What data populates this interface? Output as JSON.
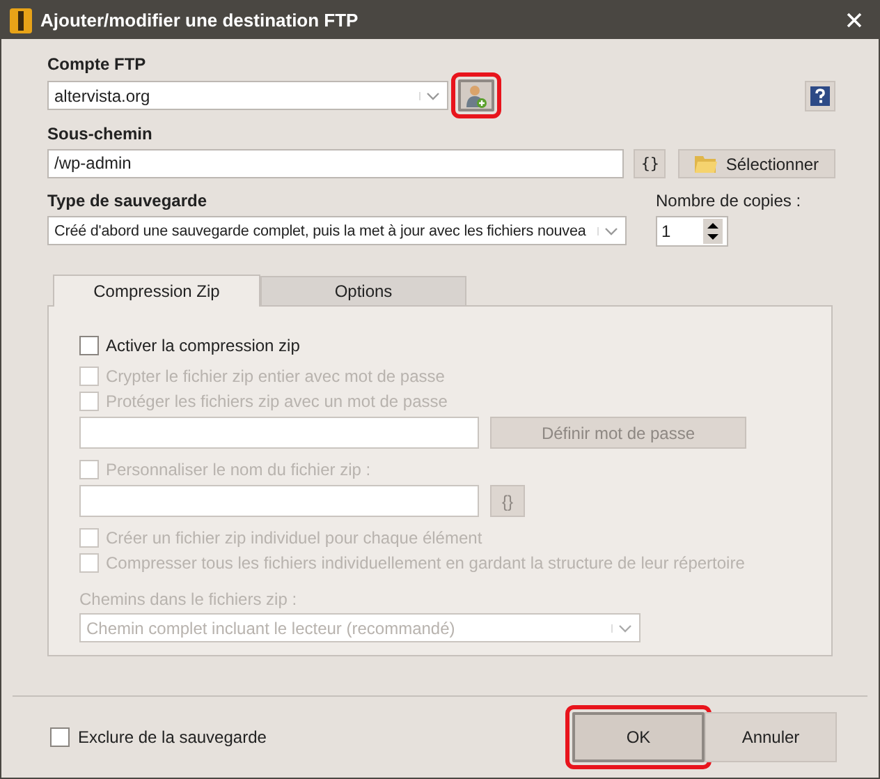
{
  "window": {
    "title": "Ajouter/modifier une destination FTP"
  },
  "account": {
    "label": "Compte FTP",
    "value": "altervista.org",
    "add_button_highlighted": true
  },
  "subpath": {
    "label": "Sous-chemin",
    "value": "/wp-admin",
    "variables_button": "{}",
    "select_button": "Sélectionner"
  },
  "backup_type": {
    "label": "Type de sauvegarde",
    "value": "Créé d'abord une sauvegarde complet, puis la met à jour avec les fichiers nouvea"
  },
  "copies": {
    "label": "Nombre de copies :",
    "value": "1"
  },
  "tabs": [
    {
      "label": "Compression Zip",
      "selected": true
    },
    {
      "label": "Options",
      "selected": false
    }
  ],
  "panel": [
    {
      "kind": "checkbox",
      "label": "Activer la compression zip",
      "checked": false,
      "disabled": false
    },
    {
      "kind": "checkbox",
      "label": "Crypter le fichier zip entier avec mot de passe",
      "checked": false,
      "disabled": true
    },
    {
      "kind": "checkbox",
      "label": "Protéger les fichiers zip avec un mot de passe",
      "checked": false,
      "disabled": true
    },
    {
      "kind": "field",
      "button": "Définir mot de passe",
      "disabled": true
    },
    {
      "kind": "checkbox",
      "label": "Personnaliser le nom du fichier zip :",
      "checked": false,
      "disabled": true
    },
    {
      "kind": "field",
      "button": "{}",
      "disabled": true
    },
    {
      "kind": "checkbox",
      "label": "Créer un fichier zip individuel pour chaque élément",
      "checked": false,
      "disabled": true
    },
    {
      "kind": "checkbox",
      "label": "Compresser tous les fichiers individuellement en gardant la structure de leur répertoire",
      "checked": false,
      "disabled": true
    },
    {
      "kind": "label",
      "label": "Chemins dans le fichiers zip :",
      "disabled": true
    },
    {
      "kind": "dropdown",
      "value": "Chemin complet incluant le lecteur (recommandé)",
      "disabled": true
    }
  ],
  "exclude": {
    "label": "Exclure de la sauvegarde",
    "checked": false
  },
  "buttons": [
    {
      "label": "OK",
      "highlighted": true
    },
    {
      "label": "Annuler",
      "highlighted": false
    }
  ]
}
